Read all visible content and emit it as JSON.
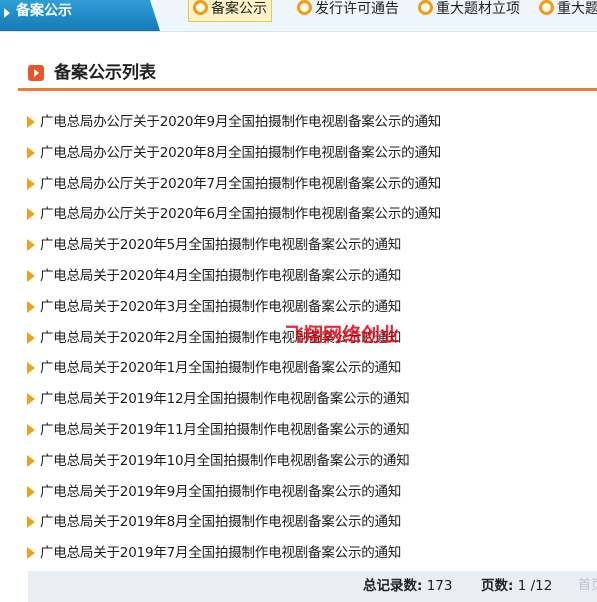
{
  "topbar": {
    "section_label": "备案公示",
    "tabs": [
      {
        "label": "备案公示",
        "active": true
      },
      {
        "label": "发行许可通告",
        "active": false
      },
      {
        "label": "重大题材立项",
        "active": false
      },
      {
        "label": "重大题",
        "active": false
      }
    ]
  },
  "panel": {
    "title": "备案公示列表"
  },
  "notices": [
    "广电总局办公厅关于2020年9月全国拍摄制作电视剧备案公示的通知",
    "广电总局办公厅关于2020年8月全国拍摄制作电视剧备案公示的通知",
    "广电总局办公厅关于2020年7月全国拍摄制作电视剧备案公示的通知",
    "广电总局办公厅关于2020年6月全国拍摄制作电视剧备案公示的通知",
    "广电总局关于2020年5月全国拍摄制作电视剧备案公示的通知",
    "广电总局关于2020年4月全国拍摄制作电视剧备案公示的通知",
    "广电总局关于2020年3月全国拍摄制作电视剧备案公示的通知",
    "广电总局关于2020年2月全国拍摄制作电视剧备案公示的通知",
    "广电总局关于2020年1月全国拍摄制作电视剧备案公示的通知",
    "广电总局关于2019年12月全国拍摄制作电视剧备案公示的通知",
    "广电总局关于2019年11月全国拍摄制作电视剧备案公示的通知",
    "广电总局关于2019年10月全国拍摄制作电视剧备案公示的通知",
    "广电总局关于2019年9月全国拍摄制作电视剧备案公示的通知",
    "广电总局关于2019年8月全国拍摄制作电视剧备案公示的通知",
    "广电总局关于2019年7月全国拍摄制作电视剧备案公示的通知"
  ],
  "watermark": "飞翔网络创业",
  "pagination": {
    "total_label": "总记录数:",
    "total": "173",
    "pages_label": "页数:",
    "pages": "1 /12",
    "first_label": "首页"
  },
  "colors": {
    "section_tab": "#1e88c7",
    "accent_orange": "#f07a3c",
    "bullet": "#efa117",
    "watermark": "#e60012"
  },
  "icons": {
    "section_tab": "triangle-right-icon",
    "tab_marker": "circle-icon",
    "title_marker": "play-square-icon",
    "list_bullet": "triangle-bullet-icon"
  }
}
